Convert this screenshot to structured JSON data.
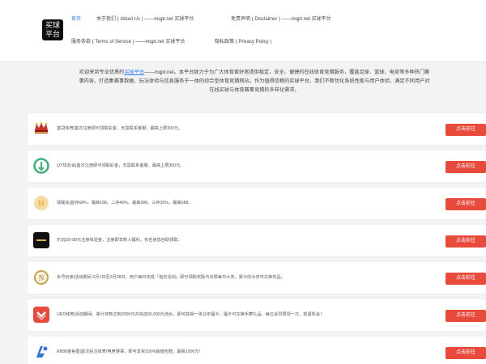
{
  "logo": {
    "line1": "买球",
    "line2": "平台"
  },
  "nav": {
    "home": "首页",
    "about": "关于我们 ( About Us ) ——mqpt.net 买球平台",
    "disclaimer": "免责声明 ( Disclaimer ) ——mqpt.net 买球平台",
    "terms": "服务条款 ( Terms of Service ) ——mqpt.net 买球平台",
    "privacy": "隐私政策 ( Privacy Policy )"
  },
  "intro": {
    "prefix": "欢迎来到专业优质的",
    "link": "买球平台",
    "line1_rest": "——mqpt.net。本平台致力于为广大体育爱好者提供稳定、安全、便捷的在线体育竞猜服务，覆盖足球、篮球、电竞等多种热门赛",
    "line2": "事内容，打造集赛事数据、玩法体验与信息服务于一体的综合型体育竞猜网站。作为值得信赖的买球平台，我们不断优化系统性能与用户体验，满足不同用户对",
    "line3": "在线买球与体育赛事竞猜的多样化需求。"
  },
  "rows": [
    {
      "icon": "crown-icon",
      "text": "皇冠体育|首次注册即可领取彩金，无需联系客服，最高上限300元。",
      "button": "点击前往",
      "color": "#8b1a1a"
    },
    {
      "icon": "qy-logo-icon",
      "text": "QY球友会|首次注册即可领取彩金，无需联系客服，最高上限300元。",
      "button": "点击前往",
      "color": "#3fb37a"
    },
    {
      "icon": "coin-logo-icon",
      "text": "球联会|首存68%，最高188。二存40%，最高388。三存30%，最高588。",
      "button": "点击前往",
      "color": "#f0c87a"
    },
    {
      "icon": "dark-logo-icon",
      "text": "乐玩|20-88元注册体验金，注册即享新人福利，实名信息自助领取。",
      "button": "点击前往",
      "color": "#1a1a1a"
    },
    {
      "icon": "n-logo-icon",
      "text": "永号玩家|活动期间 2月1日至2月28日，用户每日完成「指定活动」即可领取奖励与点赞每日大奖，累计的大奖可兑换奖品。",
      "button": "点击前往",
      "color": "#c9a24a"
    },
    {
      "icon": "arrow-logo-icon",
      "text": "UED体育|活动期间，累计存款达到2000元并完成30,000元流水，即可获得一张马年福卡，福卡可兑换手摩礼品，每位会员限领一次，抓紧机会！",
      "button": "点击前往",
      "color": "#e84b3c"
    },
    {
      "icon": "rb-logo-icon",
      "text": "RB88金裕盈|首次投注体育/电竞赛事，即可享受100%输值包赔，最高1000元！",
      "button": "点击前往",
      "color": "#2f6fe0"
    }
  ]
}
